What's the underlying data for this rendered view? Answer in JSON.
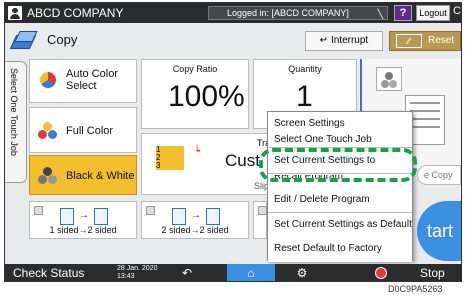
{
  "topbar": {
    "company": "ABCD COMPANY",
    "login_status": "Logged in: [ABCD COMPANY]",
    "help_label": "?",
    "logout_label": "Logout",
    "edge_label": "C"
  },
  "title_row": {
    "title": "Copy",
    "interrupt_label": "Interrupt",
    "reset_label": "Reset"
  },
  "side_tab": {
    "label": "Select One Touch Job"
  },
  "color_modes": [
    {
      "label": "Auto Color Select",
      "selected": false
    },
    {
      "label": "Full Color",
      "selected": false
    },
    {
      "label": "Black & White",
      "selected": true
    }
  ],
  "copy_ratio": {
    "label": "Copy Ratio",
    "value": "100%"
  },
  "quantity": {
    "label": "Quantity",
    "value": "1"
  },
  "tray_tile": {
    "partial_top": "Tra",
    "main_text": "Cust",
    "bottom_text": "Slip",
    "tray_numbers": [
      "1",
      "2",
      "3"
    ]
  },
  "duplex_tiles": [
    {
      "label": "1 sided→2 sided"
    },
    {
      "label": "2 sided→2 sided"
    }
  ],
  "prefs_label": "e Copy",
  "start_label": "tart",
  "menu": {
    "items": [
      "Screen Settings",
      "Select One Touch Job",
      "Set Current Settings to Program",
      "Recall Program",
      "Edit / Delete Program",
      "Set Current Settings as Default",
      "Reset Default to Factory Default"
    ],
    "highlighted_index": 2,
    "highlight_color": "#14a34a"
  },
  "bottombar": {
    "check_status": "Check Status",
    "date": "28 Jan. 2020",
    "time": "13:43",
    "stop_label": "Stop"
  },
  "figure_code": "D0C9PA5263"
}
